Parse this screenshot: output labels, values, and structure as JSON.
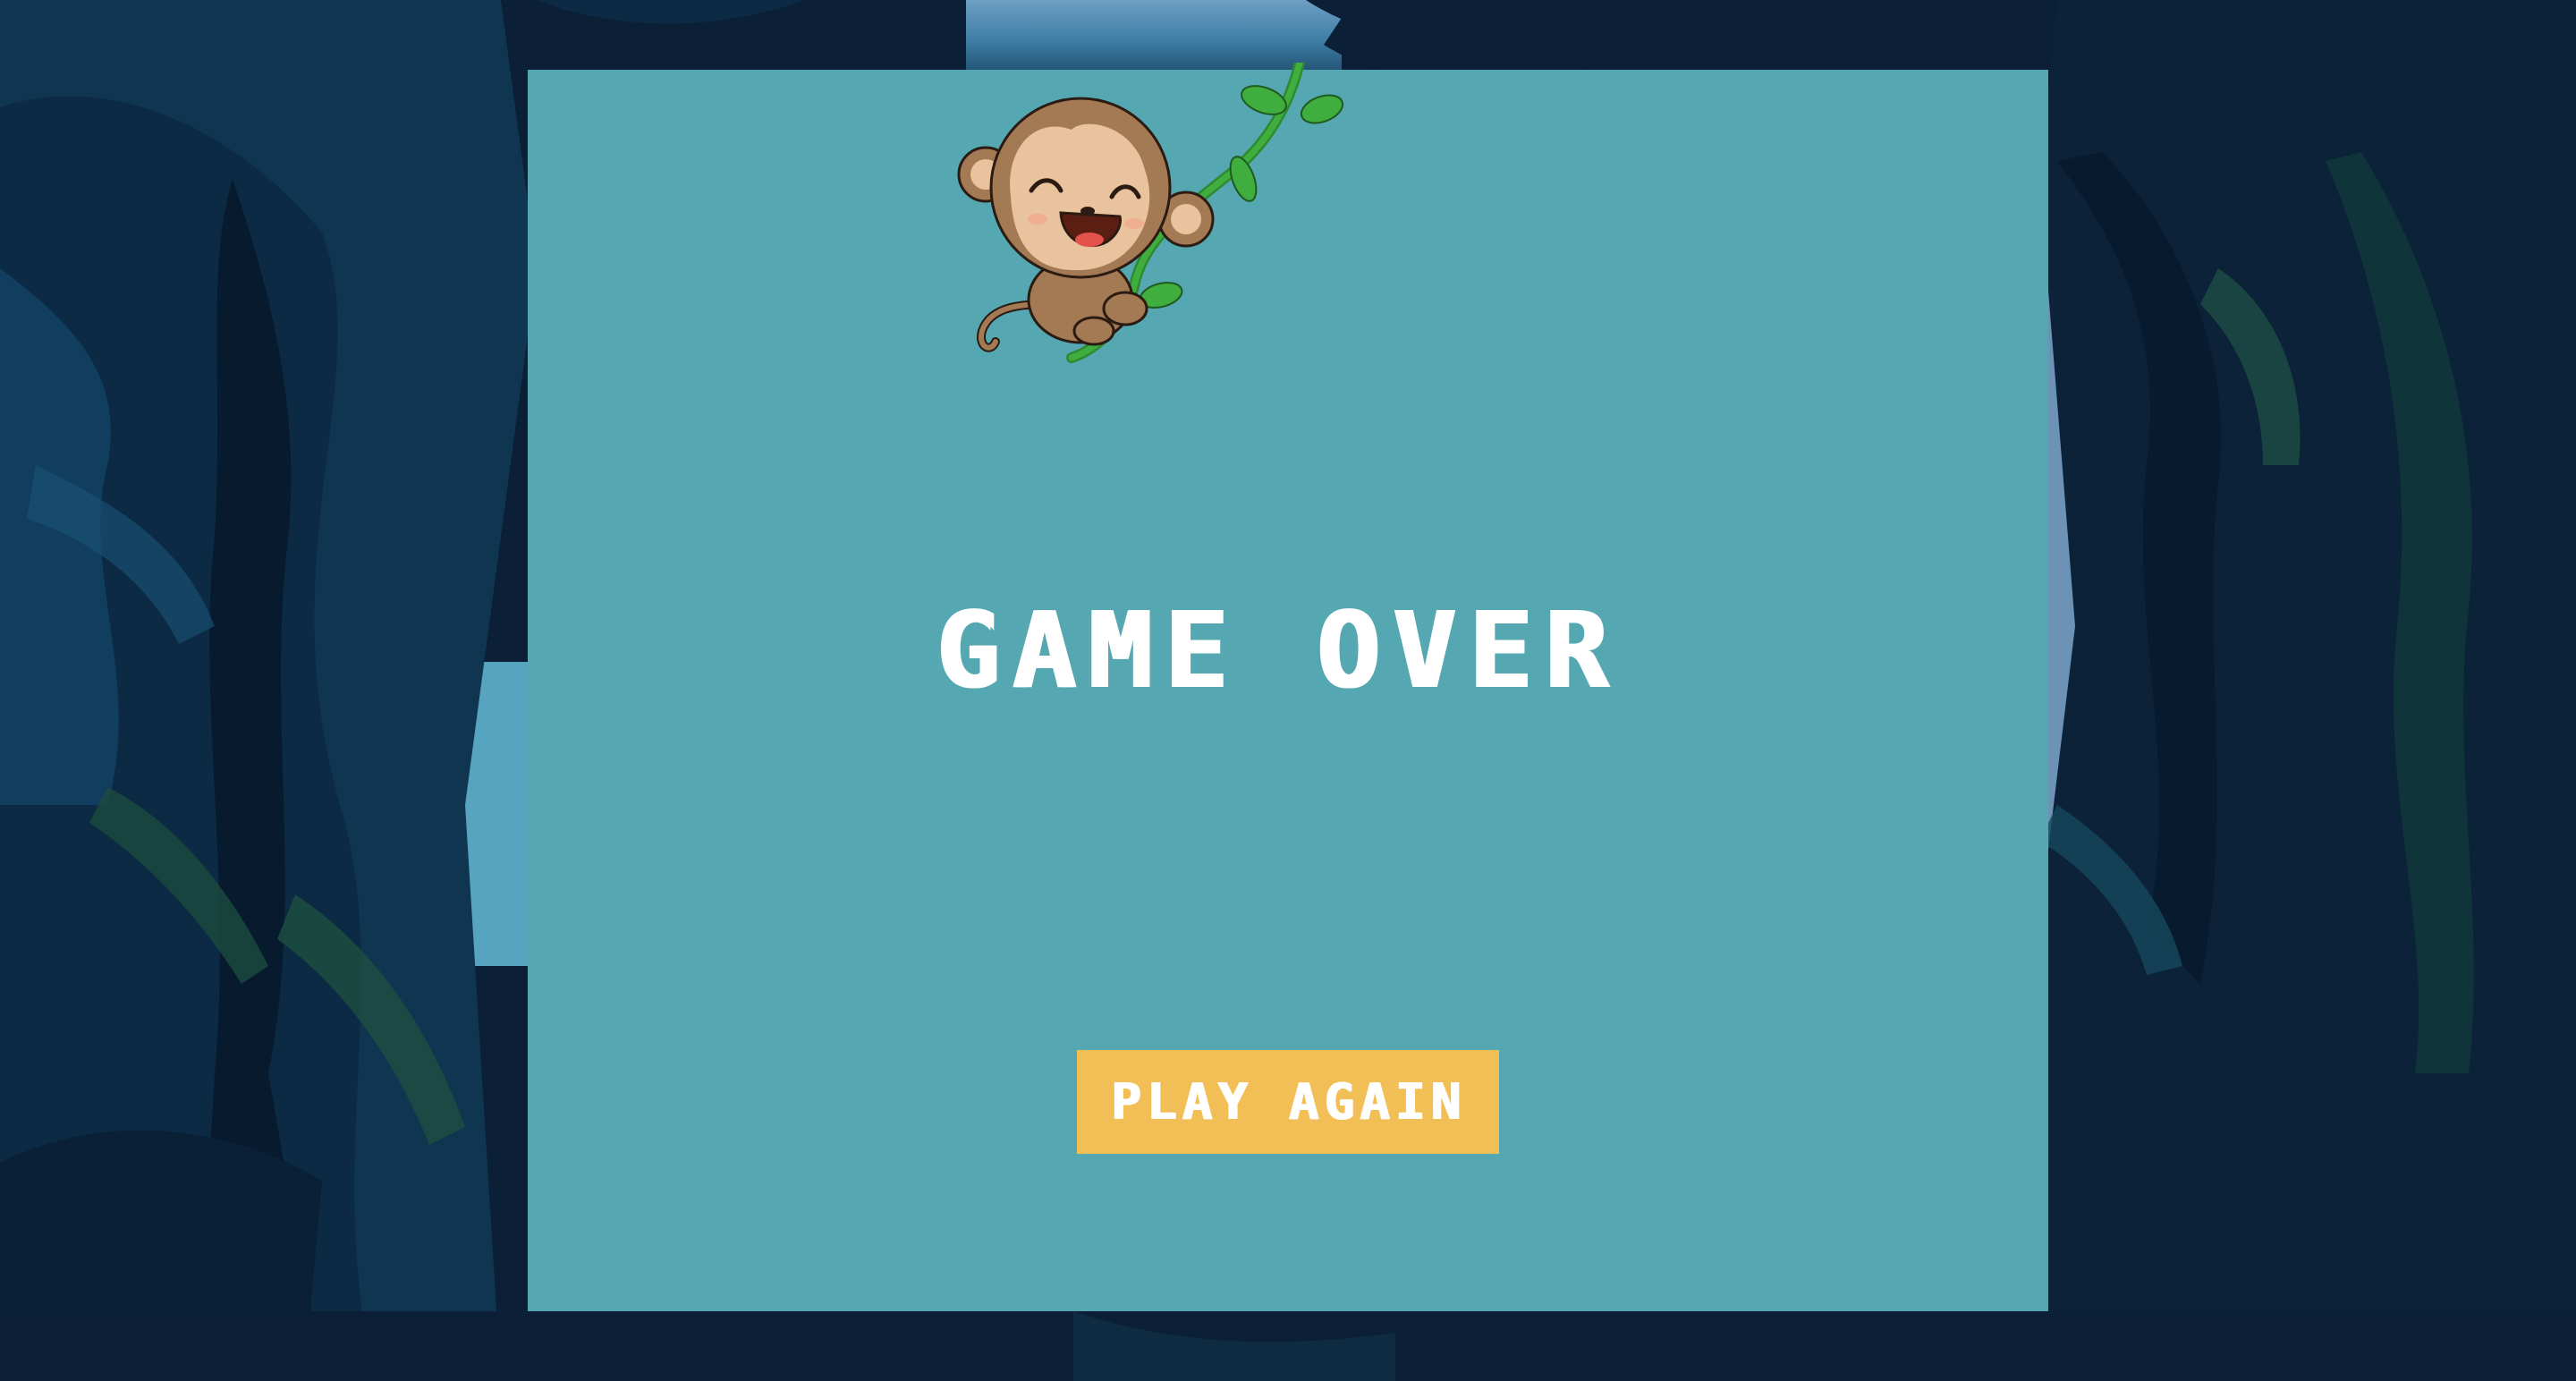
{
  "game": {
    "title": "GAME OVER",
    "play_again_label": "PLAY AGAIN"
  },
  "colors": {
    "background_dark": "#0b1f36",
    "panel": "#55a7b1",
    "button": "#f2bf57",
    "text": "#ffffff"
  },
  "icons": {
    "character": "monkey-on-vine-icon"
  }
}
